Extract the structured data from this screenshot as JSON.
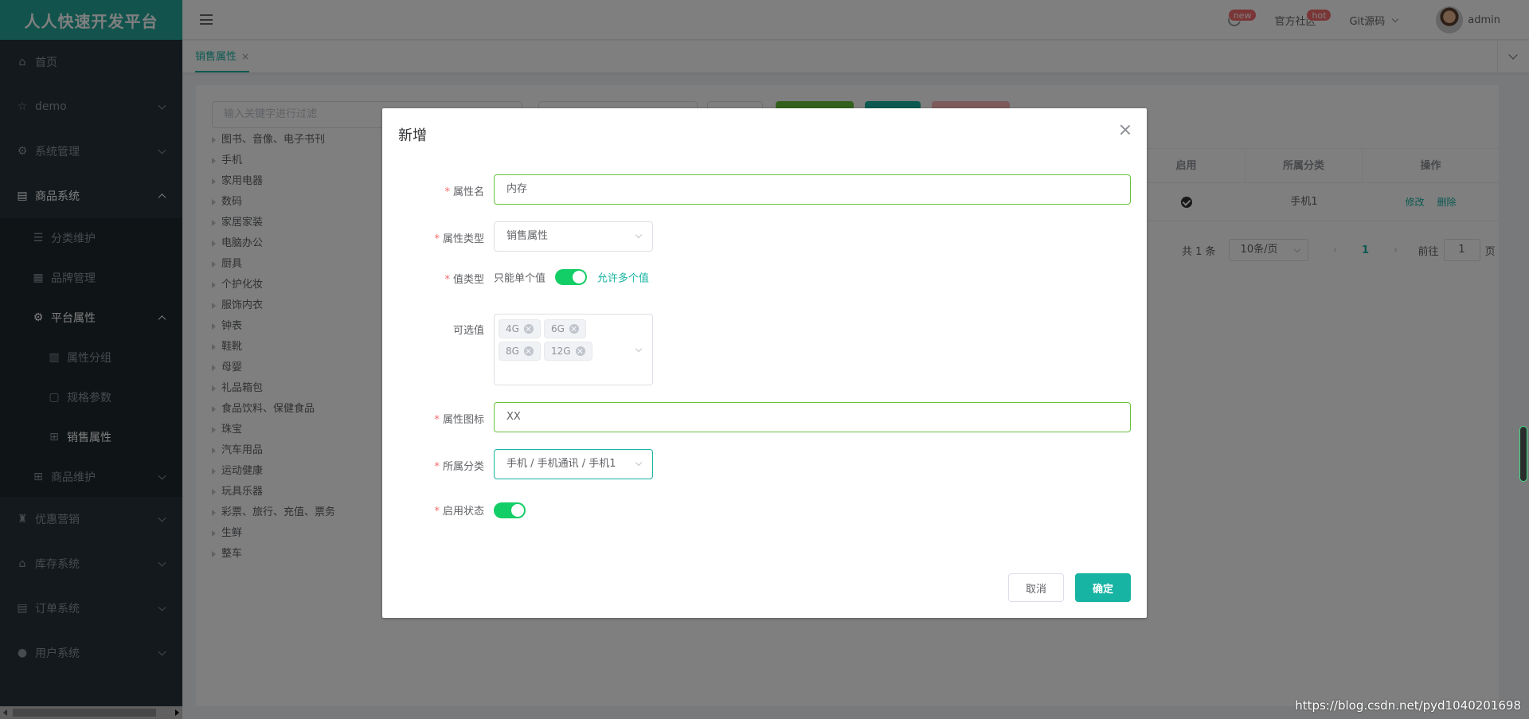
{
  "brand": "人人快速开发平台",
  "sidebar": {
    "items": [
      {
        "label": "首页",
        "icon": "home-icon"
      },
      {
        "label": "demo",
        "icon": "star-icon"
      },
      {
        "label": "系统管理",
        "icon": "gear-icon"
      },
      {
        "label": "商品系统",
        "icon": "goods-icon"
      },
      {
        "label": "分类维护",
        "icon": "list-icon"
      },
      {
        "label": "品牌管理",
        "icon": "brand-icon"
      },
      {
        "label": "平台属性",
        "icon": "gear-icon"
      },
      {
        "label": "属性分组",
        "icon": "chart-icon"
      },
      {
        "label": "规格参数",
        "icon": "doc-icon"
      },
      {
        "label": "销售属性",
        "icon": "grid-icon"
      },
      {
        "label": "商品维护",
        "icon": "grid-icon"
      },
      {
        "label": "优惠营销",
        "icon": "cup-icon"
      },
      {
        "label": "库存系统",
        "icon": "home-icon"
      },
      {
        "label": "订单系统",
        "icon": "order-icon"
      },
      {
        "label": "用户系统",
        "icon": "user-icon"
      }
    ]
  },
  "header": {
    "badge_new": "new",
    "community": "官方社区",
    "badge_hot": "hot",
    "git": "Git源码",
    "user": "admin"
  },
  "tabs": {
    "active": "销售属性",
    "close": "×"
  },
  "content": {
    "filter_placeholder": "输入关键字进行过滤",
    "tree": [
      "图书、音像、电子书刊",
      "手机",
      "家用电器",
      "数码",
      "家居家装",
      "电脑办公",
      "厨具",
      "个护化妆",
      "服饰内衣",
      "钟表",
      "鞋靴",
      "母婴",
      "礼品箱包",
      "食品饮料、保健食品",
      "珠宝",
      "汽车用品",
      "运动健康",
      "玩具乐器",
      "彩票、旅行、充值、票务",
      "生鲜",
      "整车"
    ],
    "table": {
      "headers": [
        "启用",
        "所属分类",
        "操作"
      ],
      "row": {
        "category": "手机1",
        "edit": "修改",
        "delete": "删除"
      }
    },
    "pager": {
      "total": "共 1 条",
      "size": "10条/页",
      "page": "1",
      "goto": "前往",
      "jump": "1",
      "suffix": "页"
    }
  },
  "dialog": {
    "title": "新增",
    "fields": {
      "name_label": "属性名",
      "name_value": "内存",
      "type_label": "属性类型",
      "type_value": "销售属性",
      "value_type_label": "值类型",
      "value_type_off": "只能单个值",
      "value_type_on": "允许多个值",
      "options_label": "可选值",
      "options": [
        "4G",
        "6G",
        "8G",
        "12G"
      ],
      "icon_label": "属性图标",
      "icon_value": "XX",
      "category_label": "所属分类",
      "category_value": "手机 / 手机通讯 / 手机1",
      "status_label": "启用状态"
    },
    "cancel": "取消",
    "confirm": "确定"
  },
  "watermark": "https://blog.csdn.net/pyd1040201698"
}
